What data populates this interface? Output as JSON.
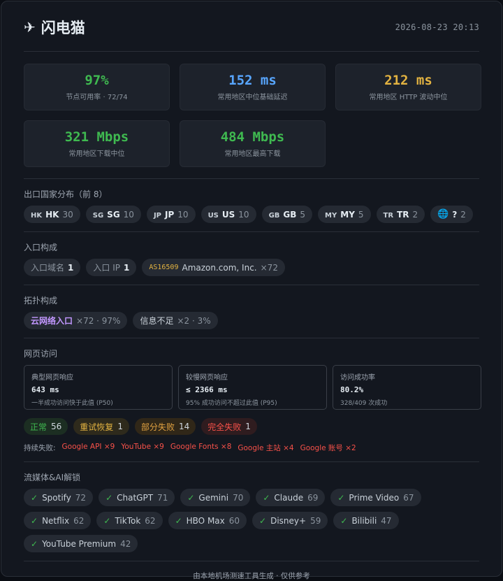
{
  "header": {
    "icon": "airplane-icon",
    "title": "闪电猫",
    "timestamp": "2026-08-23 20:13"
  },
  "metrics": [
    {
      "value": "97%",
      "label": "节点可用率 · 72/74",
      "color": "#3fb950"
    },
    {
      "value": "152 ms",
      "label": "常用地区中位基础延迟",
      "color": "#58a6ff"
    },
    {
      "value": "212 ms",
      "label": "常用地区 HTTP 波动中位",
      "color": "#e3b341"
    },
    {
      "value": "321 Mbps",
      "label": "常用地区下载中位",
      "color": "#3fb950"
    },
    {
      "value": "484 Mbps",
      "label": "常用地区最高下载",
      "color": "#3fb950"
    }
  ],
  "countries": {
    "title": "出口国家分布（前 8）",
    "items": [
      {
        "flag": "HK",
        "code": "HK",
        "count": "30"
      },
      {
        "flag": "SG",
        "code": "SG",
        "count": "10"
      },
      {
        "flag": "JP",
        "code": "JP",
        "count": "10"
      },
      {
        "flag": "US",
        "code": "US",
        "count": "10"
      },
      {
        "flag": "GB",
        "code": "GB",
        "count": "5"
      },
      {
        "flag": "MY",
        "code": "MY",
        "count": "5"
      },
      {
        "flag": "TR",
        "code": "TR",
        "count": "2"
      },
      {
        "flag": "🌐",
        "code": "?",
        "count": "2"
      }
    ]
  },
  "entry": {
    "title": "入口构成",
    "domain_label": "入口域名",
    "domain_count": "1",
    "ip_label": "入口 IP",
    "ip_count": "1",
    "asn": "AS16509",
    "asn_name": "Amazon.com, Inc.",
    "asn_count": "×72"
  },
  "topology": {
    "title": "拓扑构成",
    "items": [
      {
        "label": "云网络入口",
        "detail": "×72 · 97%"
      },
      {
        "label": "信息不足",
        "detail": "×2 · 3%"
      }
    ]
  },
  "web": {
    "title": "网页访问",
    "boxes": [
      {
        "label": "典型网页响应",
        "value": "643 ms",
        "note": "一半成功访问快于此值 (P50)"
      },
      {
        "label": "较慢网页响应",
        "value": "≤ 2366 ms",
        "note": "95% 成功访问不超过此值 (P95)"
      },
      {
        "label": "访问成功率",
        "value": "80.2%",
        "note": "328/409 次成功"
      }
    ],
    "statuses": [
      {
        "label": "正常",
        "count": "56"
      },
      {
        "label": "重试恢复",
        "count": "1"
      },
      {
        "label": "部分失败",
        "count": "14"
      },
      {
        "label": "完全失败",
        "count": "1"
      }
    ],
    "persistent_label": "持续失败:",
    "persistent": [
      "Google API ×9",
      "YouTube ×9",
      "Google Fonts ×8",
      "Google 主站 ×4",
      "Google 账号 ×2"
    ]
  },
  "media": {
    "title": "流媒体&AI解锁",
    "items": [
      {
        "name": "Spotify",
        "count": "72"
      },
      {
        "name": "ChatGPT",
        "count": "71"
      },
      {
        "name": "Gemini",
        "count": "70"
      },
      {
        "name": "Claude",
        "count": "69"
      },
      {
        "name": "Prime Video",
        "count": "67"
      },
      {
        "name": "Netflix",
        "count": "62"
      },
      {
        "name": "TikTok",
        "count": "62"
      },
      {
        "name": "HBO Max",
        "count": "60"
      },
      {
        "name": "Disney+",
        "count": "59"
      },
      {
        "name": "Bilibili",
        "count": "47"
      },
      {
        "name": "YouTube Premium",
        "count": "42"
      }
    ]
  },
  "footer": {
    "text": "由本地机场测速工具生成 · 仅供参考"
  }
}
